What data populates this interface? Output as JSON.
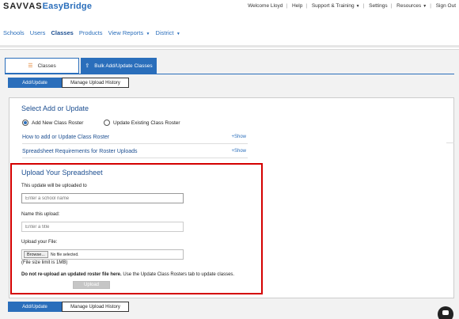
{
  "brand": {
    "part1": "SAVVAS",
    "part2": "EasyBridge"
  },
  "top_links": [
    "Welcome Lloyd",
    "Help",
    "Support & Training",
    "Settings",
    "Resources",
    "Sign Out"
  ],
  "nav": {
    "schools": "Schools",
    "users": "Users",
    "classes": "Classes",
    "products": "Products",
    "view_reports": "View Reports",
    "district": "District"
  },
  "tabs": {
    "classes": "Classes",
    "bulk": "Bulk Add/Update Classes"
  },
  "subbuttons": {
    "add_update": "Add/Update",
    "history": "Manage Upload History"
  },
  "select_section": {
    "title": "Select Add or Update",
    "option_new": "Add New Class Roster",
    "option_existing": "Update Existing Class Roster",
    "selected": "Add New Class Roster"
  },
  "rows": [
    {
      "label": "How to add or Update Class Roster",
      "action": "Show"
    },
    {
      "label": "Spreadsheet Requirements for Roster Uploads",
      "action": "Show"
    }
  ],
  "upload": {
    "title": "Upload Your Spreadsheet",
    "school_label": "This update will be uploaded to",
    "school_placeholder": "Enter a school name",
    "name_label": "Name this upload:",
    "name_placeholder": "Enter a title",
    "file_label": "Upload your File:",
    "browse": "Browse...",
    "no_file": "No file selected.",
    "size_limit": "(File size limit is 1MB)",
    "warning_bold": "Do not re-upload an updated roster file here.",
    "warning_rest": " Use the Update Class Rosters tab to update classes.",
    "upload_button": "Upload"
  },
  "icons": {
    "classes_tab": "list-icon",
    "bulk_tab": "upload-icon",
    "plus": "plus-icon",
    "chat": "chat-icon"
  },
  "colors": {
    "accent": "#2a6ebb",
    "highlight_border": "#d40000"
  }
}
